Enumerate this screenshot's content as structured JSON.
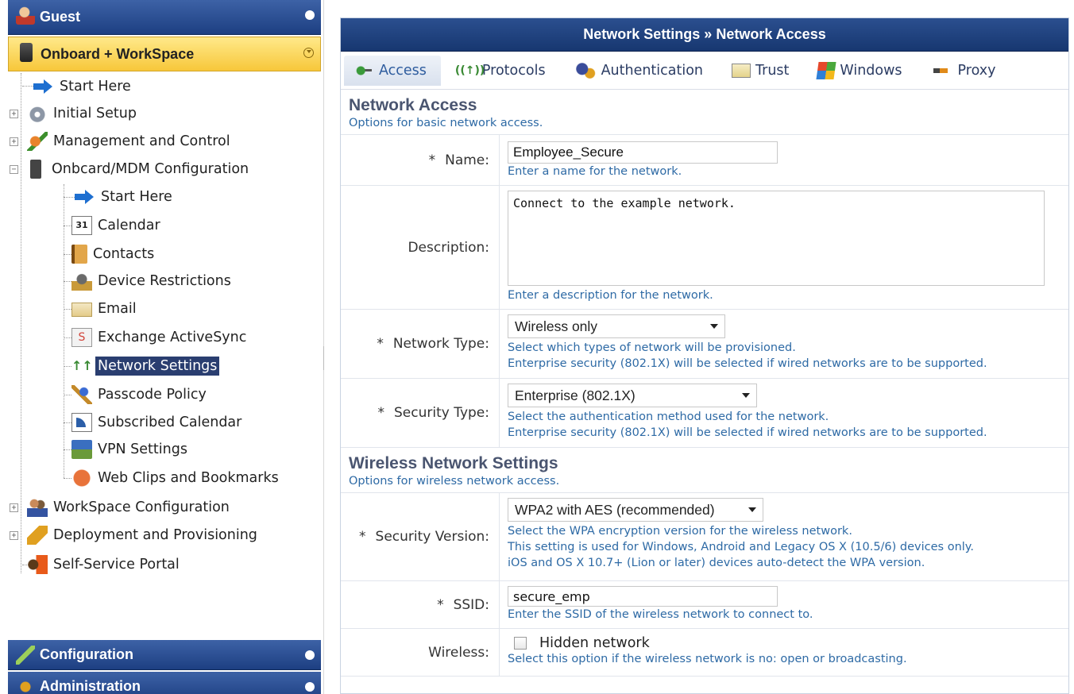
{
  "sidebar": {
    "guest_label": "Guest",
    "onboard_label": "Onboard + WorkSpace",
    "configuration_label": "Configuration",
    "administration_label": "Administration",
    "tree": [
      {
        "label": "Start Here",
        "icon": "arrow-right-icon"
      },
      {
        "label": "Initial Setup",
        "icon": "gear-icon"
      },
      {
        "label": "Management and Control",
        "icon": "management-icon"
      },
      {
        "label": "Onbcard/MDM Configuration",
        "icon": "mobile-config-icon"
      },
      {
        "label": "Start Here",
        "icon": "arrow-right-icon"
      },
      {
        "label": "Calendar",
        "icon": "calendar-icon",
        "icon_text": "31"
      },
      {
        "label": "Contacts",
        "icon": "contacts-book-icon"
      },
      {
        "label": "Device Restrictions",
        "icon": "device-restrictions-icon"
      },
      {
        "label": "Email",
        "icon": "email-icon"
      },
      {
        "label": "Exchange ActiveSync",
        "icon": "exchange-sync-icon"
      },
      {
        "label": "Network Settings",
        "icon": "network-icon",
        "selected": true
      },
      {
        "label": "Passcode Policy",
        "icon": "passcode-key-icon"
      },
      {
        "label": "Subscribed Calendar",
        "icon": "rss-calendar-icon"
      },
      {
        "label": "VPN Settings",
        "icon": "vpn-icon"
      },
      {
        "label": "Web Clips and Bookmarks",
        "icon": "web-clips-icon"
      },
      {
        "label": "WorkSpace Configuration",
        "icon": "people-icon"
      },
      {
        "label": "Deployment and Provisioning",
        "icon": "deployment-icon"
      },
      {
        "label": "Self-Service Portal",
        "icon": "portal-icon"
      }
    ]
  },
  "main": {
    "title": "Network Settings » Network Access",
    "tabs": [
      {
        "label": "Access",
        "icon": "access-icon",
        "active": true
      },
      {
        "label": "Protocols",
        "icon": "protocols-icon"
      },
      {
        "label": "Authentication",
        "icon": "authentication-icon"
      },
      {
        "label": "Trust",
        "icon": "trust-certificate-icon"
      },
      {
        "label": "Windows",
        "icon": "windows-icon"
      },
      {
        "label": "Proxy",
        "icon": "proxy-icon"
      }
    ],
    "network_access": {
      "title": "Network Access",
      "subtitle": "Options for basic network access.",
      "name": {
        "label": "Name:",
        "required": "*",
        "value": "Employee_Secure",
        "hint": "Enter a name for the network."
      },
      "description": {
        "label": "Description:",
        "value": "Connect to the example network.",
        "hint": "Enter a description for the network."
      },
      "network_type": {
        "label": "Network Type:",
        "required": "*",
        "value": "Wireless only",
        "hint1": "Select which types of network will be provisioned.",
        "hint2": "Enterprise security (802.1X) will be selected if wired networks are to be supported."
      },
      "security_type": {
        "label": "Security Type:",
        "required": "*",
        "value": "Enterprise (802.1X)",
        "hint1": "Select the authentication method used for the network.",
        "hint2": "Enterprise security (802.1X) will be selected if wired networks are to be supported."
      }
    },
    "wireless": {
      "title": "Wireless Network Settings",
      "subtitle": "Options for wireless network access.",
      "security_version": {
        "label": "Security Version:",
        "required": "*",
        "value": "WPA2 with AES (recommended)",
        "hint1": "Select the WPA encryption version for the wireless network.",
        "hint2": "This setting is used for Windows, Android and Legacy OS X (10.5/6) devices only.",
        "hint3": "iOS and OS X 10.7+ (Lion or later) devices auto-detect the WPA version."
      },
      "ssid": {
        "label": "SSID:",
        "required": "*",
        "value": "secure_emp",
        "hint": "Enter the SSID of the wireless network to connect to."
      },
      "wireless": {
        "label": "Wireless:",
        "checkbox_label": "Hidden network",
        "checked": false,
        "hint": "Select this option if the wireless network is no: open or broadcasting."
      }
    }
  }
}
